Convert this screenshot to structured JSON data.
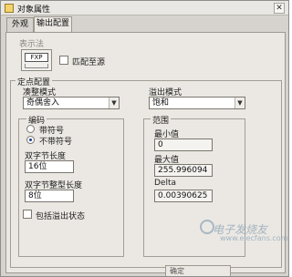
{
  "window": {
    "title": "对象属性",
    "close": "✕"
  },
  "tabs": [
    {
      "label": "外观"
    },
    {
      "label": "输出配置"
    }
  ],
  "display": {
    "label": "表示法",
    "fxp_text": "FXP",
    "match_source_label": "匹配至源"
  },
  "fixed_config": {
    "label": "定点配置",
    "rounding_label": "凑整模式",
    "rounding_value": "奇偶舍入",
    "overflow_label": "溢出模式",
    "overflow_value": "饱和"
  },
  "encoding": {
    "label": "编码",
    "signed_label": "带符号",
    "unsigned_label": "不带符号",
    "word_length_label": "双字节长度",
    "word_length_value": "16位",
    "int_word_length_label": "双字节整型长度",
    "int_word_length_value": "8位"
  },
  "range": {
    "label": "范围",
    "min_label": "最小值",
    "min_value": "0",
    "max_label": "最大值",
    "max_value": "255.996094",
    "delta_label": "Delta",
    "delta_value": "0.00390625"
  },
  "include_overflow_label": "包括溢出状态",
  "bottom_button": {
    "label": "确定"
  },
  "watermark": {
    "text": "电子发烧友",
    "url": "www.elecfans.com"
  }
}
